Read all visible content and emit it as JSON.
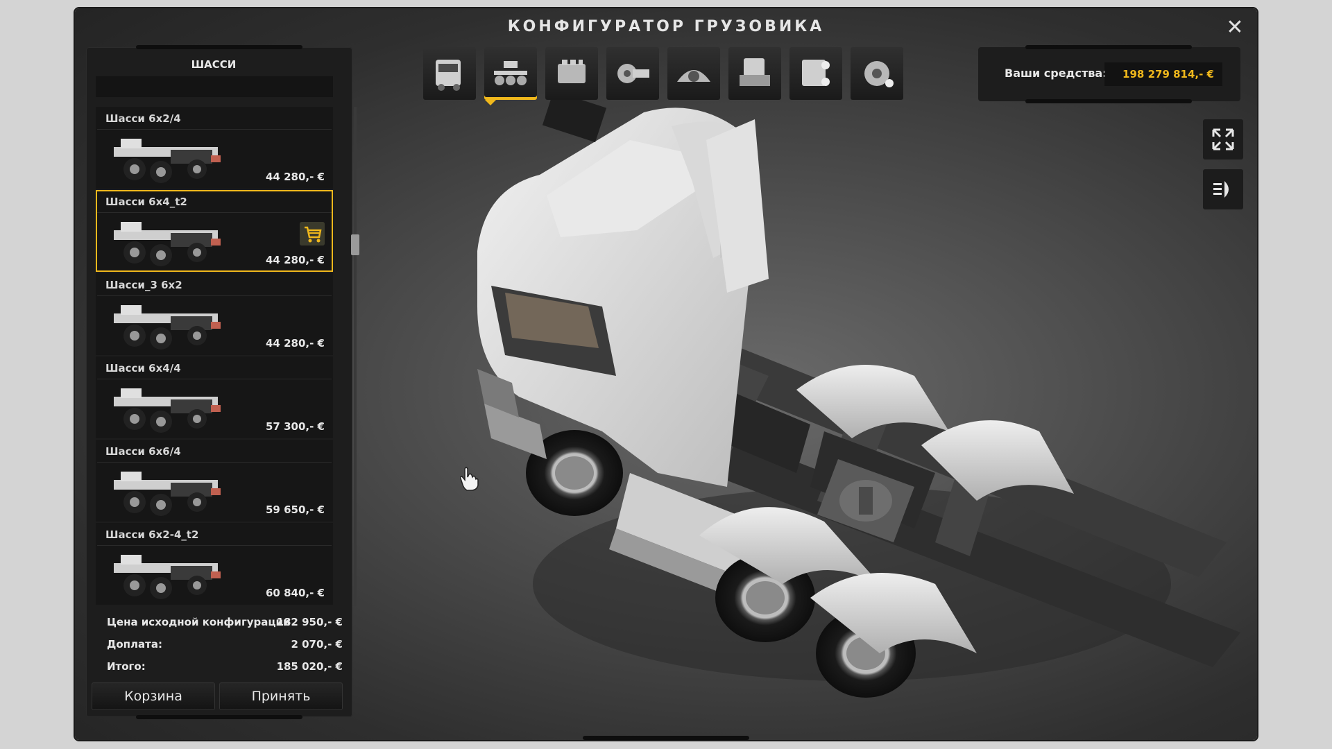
{
  "window": {
    "title": "КОНФИГУРАТОР ГРУЗОВИКА",
    "close_glyph": "✕"
  },
  "panel": {
    "header": "ШАССИ",
    "items": [
      {
        "name": "Шасси 6x2/4",
        "price": "44 280,- €",
        "selected": false
      },
      {
        "name": "Шасси 6x4_t2",
        "price": "44 280,- €",
        "selected": true
      },
      {
        "name": "Шасси_3 6x2",
        "price": "44 280,- €",
        "selected": false
      },
      {
        "name": "Шасси 6x4/4",
        "price": "57 300,- €",
        "selected": false
      },
      {
        "name": "Шасси 6x6/4",
        "price": "59 650,- €",
        "selected": false
      },
      {
        "name": "Шасси 6x2-4_t2",
        "price": "60 840,- €",
        "selected": false
      }
    ],
    "summary": {
      "base_label": "Цена исходной конфигурации",
      "base_value": "182 950,- €",
      "extra_label": "Доплата:",
      "extra_value": "2 070,- €",
      "total_label": "Итого:",
      "total_value": "185 020,- €"
    },
    "buttons": {
      "cart": "Корзина",
      "accept": "Принять"
    }
  },
  "toolbar": {
    "tabs": [
      {
        "icon": "cabin-icon"
      },
      {
        "icon": "chassis-icon",
        "active": true
      },
      {
        "icon": "engine-icon"
      },
      {
        "icon": "transmission-icon"
      },
      {
        "icon": "interior-icon"
      },
      {
        "icon": "cab-accessories-icon"
      },
      {
        "icon": "lights-icon"
      },
      {
        "icon": "wheels-icon"
      }
    ]
  },
  "funds": {
    "label": "Ваши средства:",
    "value": "198 279 814,- €"
  },
  "colors": {
    "accent": "#f0b81c",
    "panel_bg": "#1d1d1d",
    "text": "#e8e8e8"
  }
}
